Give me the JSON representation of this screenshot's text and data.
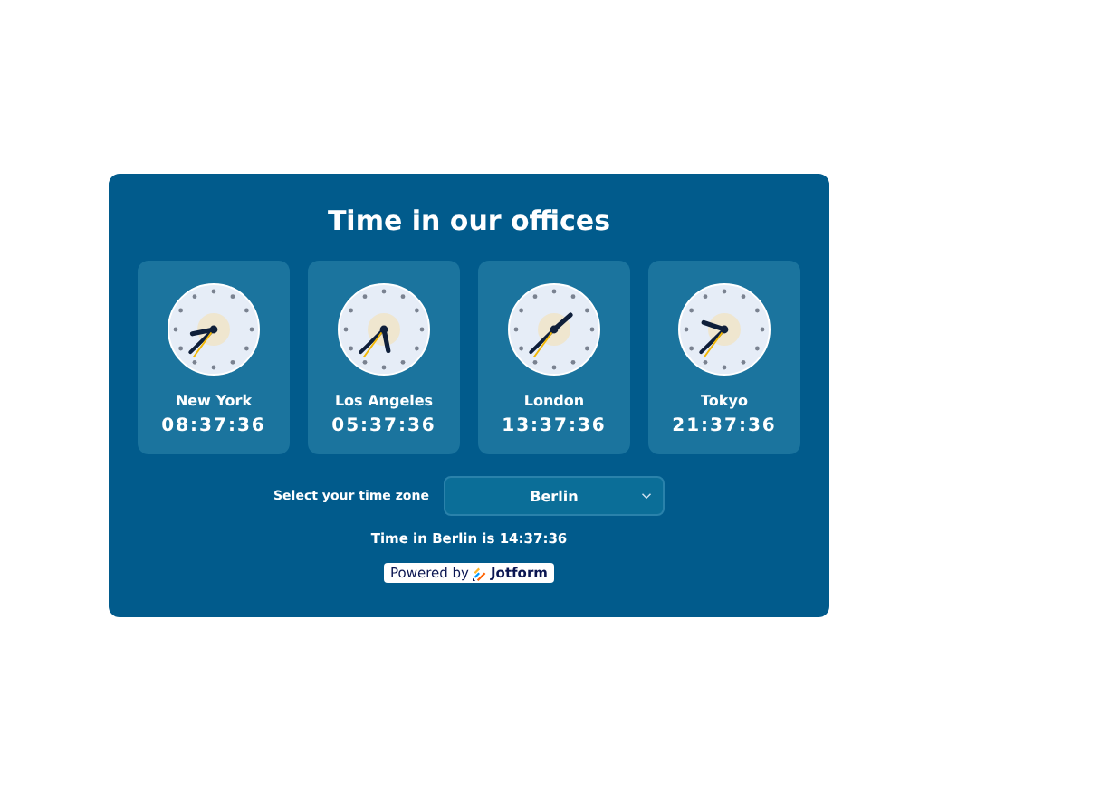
{
  "title": "Time in our offices",
  "clocks": [
    {
      "city": "New York",
      "time": "08:37:36"
    },
    {
      "city": "Los Angeles",
      "time": "05:37:36"
    },
    {
      "city": "London",
      "time": "13:37:36"
    },
    {
      "city": "Tokyo",
      "time": "21:37:36"
    }
  ],
  "selector": {
    "label": "Select your time zone",
    "value": "Berlin"
  },
  "result": "Time in Berlin is 14:37:36",
  "badge": {
    "prefix": "Powered by",
    "brand": "Jotform"
  }
}
